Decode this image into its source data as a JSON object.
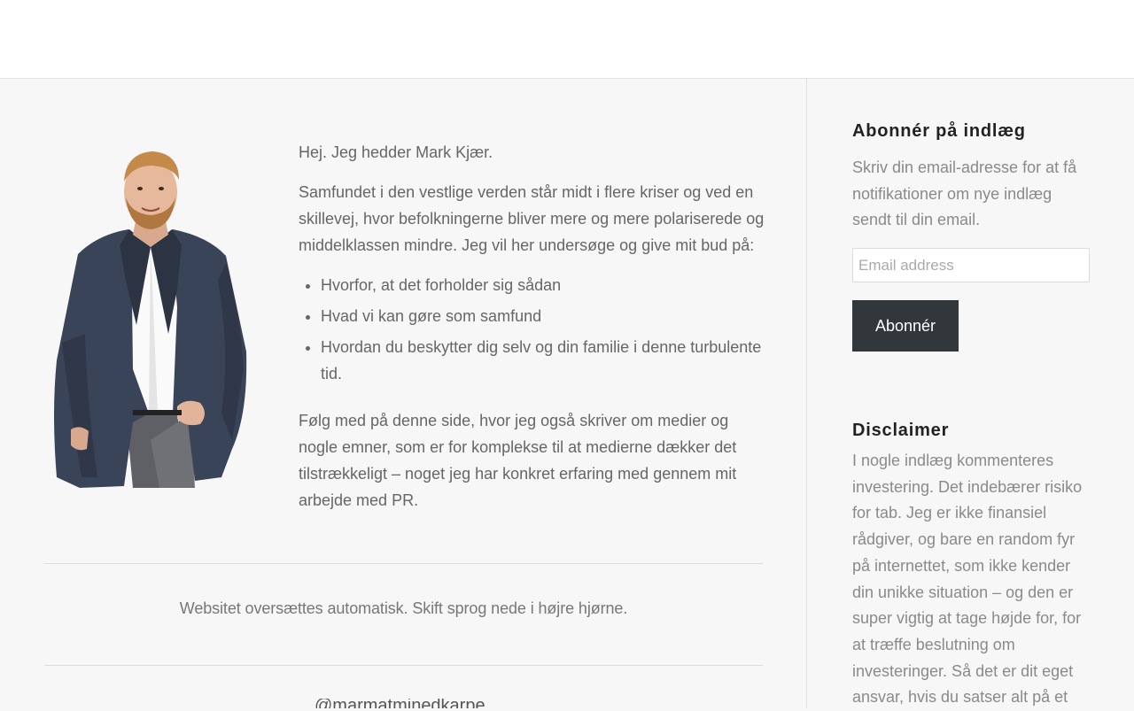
{
  "main": {
    "intro": {
      "hello": "Hej. Jeg hedder Mark Kjær.",
      "paragraph1": "Samfundet i den vestlige verden står midt i flere kriser og ved en skillevej, hvor befolkningerne bliver mere og mere polariserede og middelklassen mindre. Jeg vil her undersøge og give mit bud på:",
      "bullets": [
        "Hvorfor, at det forholder sig sådan",
        "Hvad vi kan gøre som samfund",
        "Hvordan du beskytter dig selv og din familie i denne turbulente tid."
      ],
      "paragraph2": "Følg med på denne side, hvor jeg også skriver om medier og nogle emner, som er for komplekse til at medierne dækker det tilstrækkeligt – noget jeg har konkret erfaring med gennem mit arbejde med PR."
    },
    "translate_note": "Websitet oversættes automatisk. Skift sprog nede i højre hjørne.",
    "peek_text": "@marmatminedkarpe"
  },
  "sidebar": {
    "subscribe": {
      "title": "Abonnér på indlæg",
      "description": "Skriv din email-adresse for at få notifikationer om nye indlæg sendt til din email.",
      "email_placeholder": "Email address",
      "button_label": "Abonnér"
    },
    "disclaimer": {
      "title": "Disclaimer",
      "text": "I nogle indlæg kommenteres investering. Det indebærer risiko for tab. Jeg er ikke finansiel rådgiver, og bare en random fyr på internettet, som ikke kender din unikke situation – og den er super vigtig at tage højde for, for at træffe beslutning om investeringer. Så det er dit eget ansvar, hvis du satser alt på et"
    }
  },
  "colors": {
    "button_bg": "#32373c",
    "jacket": "#3a4459",
    "shirt": "#ffffff",
    "pants": "#6b6b70"
  }
}
